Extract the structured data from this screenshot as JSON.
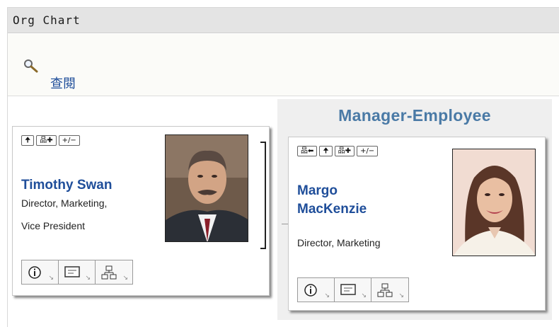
{
  "panel": {
    "title": "Org Chart"
  },
  "lookup": {
    "icon": "magnifier-icon",
    "label": "查閱"
  },
  "manager_employee": {
    "title": "Manager-Employee",
    "title_color": "#4a7aa6"
  },
  "manager_card": {
    "toolbar": {
      "up": "🠉",
      "expand": "品✚",
      "toggle": "+/−"
    },
    "name": "Timothy Swan",
    "title_line1": "Director, Marketing,",
    "title_line2": "Vice President",
    "actions": [
      "info-icon",
      "message-card-icon",
      "org-chart-icon"
    ]
  },
  "employee_card": {
    "toolbar": {
      "back": "品⬅",
      "up": "🠉",
      "expand": "品✚",
      "toggle": "+/−"
    },
    "name": "Margo MacKenzie",
    "title_line1": "Director, Marketing",
    "actions": [
      "info-icon",
      "message-card-icon",
      "org-chart-icon"
    ]
  },
  "colors": {
    "link": "#1f4e9a",
    "panel_bg": "#efefef",
    "header_bg": "#e4e4e4"
  }
}
